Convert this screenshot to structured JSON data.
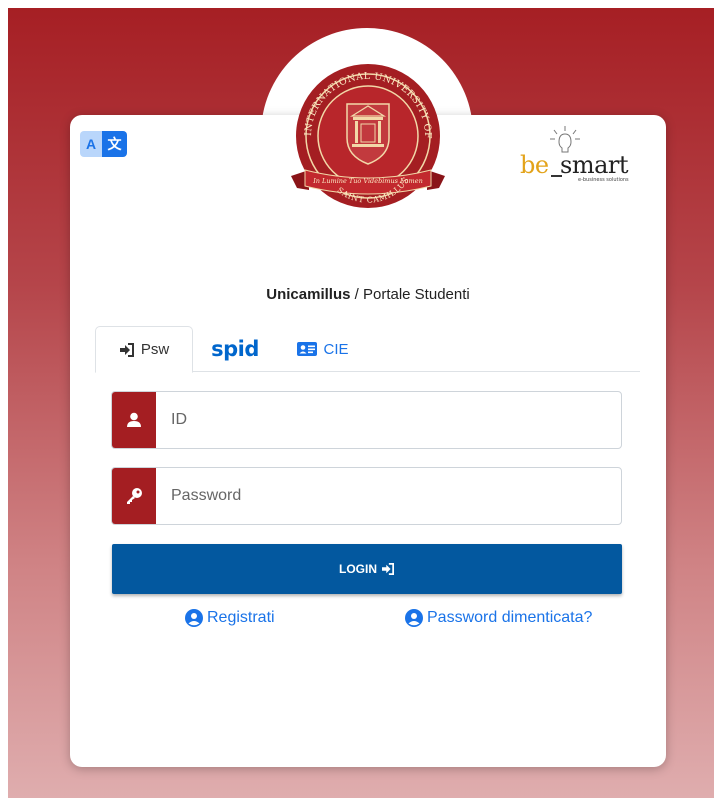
{
  "translate": {
    "label_a": "A",
    "label_b": "文"
  },
  "title": {
    "brand": "Unicamillus",
    "separator": " / ",
    "portal": "Portale Studenti"
  },
  "tabs": [
    {
      "label": "Psw",
      "active": true
    },
    {
      "label": "spid",
      "active": false
    },
    {
      "label": "CIE",
      "active": false
    }
  ],
  "form": {
    "id_placeholder": "ID",
    "id_value": "",
    "password_placeholder": "Password",
    "password_value": "",
    "login_label": "LOGIN"
  },
  "links": {
    "register": "Registrati",
    "forgot_password": "Password dimenticata?"
  },
  "logo": {
    "top_text": "INTERNATIONAL UNIVERSITY OF HEALTH SCIENCES",
    "ribbon_text": "In Lumine Tuo Videbimus Lumen",
    "bottom_text": "SAINT CAMILLUS"
  },
  "partner_logo": {
    "be": "be",
    "smart": "smart",
    "tagline": "e-business solutions"
  },
  "colors": {
    "brand_red": "#a41e22",
    "button_blue": "#03589f",
    "link_blue": "#1a73e8",
    "spid_blue": "#0066cc"
  }
}
